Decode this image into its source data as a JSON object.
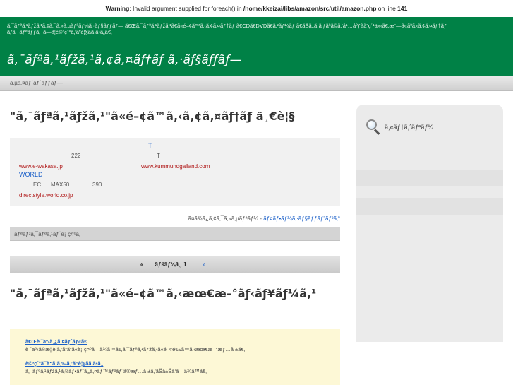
{
  "warning": {
    "label": "Warning",
    "message": ": Invalid argument supplied for foreach() in ",
    "path": "/home/kkeizai/libs/amazon/src/util/amazon.php",
    "line_text": " on line ",
    "line_number": "141"
  },
  "header": {
    "tagline": "ã‚¯ãƒªã‚¹ãƒžã‚¹ã‚¢ã‚¯ã‚»ã‚µãƒªãƒ¼ã‚·ãƒ§ãƒƒãƒ— ã€Œã‚¯ãƒªã‚¹ãƒžã‚¹ã€ã«é–¢ã™ã‚‹ã‚¢ã‚¤ãƒ†ãƒ ã€CDã€DVDã€ã‚²ãƒ¼ãƒ ã€ãŠã‚‚ã¡ã‚ƒãªã©ã‚’å¹…åºƒãã”ç´¹ä»‹ã€‚æ°—ã«ãªã‚‹ã‚¢ã‚¤ãƒ†ãƒ ã‚’ã‚¯ãƒªãƒƒã‚¯ã—ã¦è©³ç´°ã‚’ã”è¦§ãã ã•ã„ã€‚",
    "site_title": "ã‚¯ãƒªã‚¹ãƒžã‚¹ã‚¢ã‚¤ãƒ†ãƒ ã‚·ãƒ§ãƒƒãƒ—"
  },
  "breadcrumb": {
    "text": "ã‚µã‚¤ãƒˆãƒˆãƒƒãƒ—"
  },
  "main": {
    "page_title": "\"ã‚¯ãƒªã‚¹ãƒžã‚¹\"ã«é–¢ã™ã‚‹ã‚¢ã‚¤ãƒ†ãƒ ä¸€è¦§",
    "ad": {
      "t1": "T",
      "n222": "222",
      "t2": "T",
      "link1": "www.e-wakasa.jp",
      "link2": "www.kummundgalland.com",
      "world": "WORLD",
      "ec": "EC",
      "max": "MAX50",
      "n390": "390",
      "link3": "directstyle.world.co.jp"
    },
    "credit_text": "ã¤ã¾ã¿ã‚¢ã‚¯ã‚»ã‚µãƒªãƒ¼ - ",
    "credit_link": "ãƒ¤ãƒ•ãƒ¼ã‚·ãƒ§ãƒƒãƒ”ãƒ³ã‚°",
    "bar_text": "ãƒªãƒ³ã‚¯ãƒªã‚¹ãƒˆè¡¨ç¤ºã‚",
    "pager": {
      "prev": "«",
      "current": "ãƒšãƒ¼ã‚¸ 1",
      "next": "»"
    },
    "section_title": "\"ã‚¯ãƒªã‚¹ãƒžã‚¹\"ã«é–¢ã™ã‚‹æœ€æ–°ãƒ‹ãƒ¥ãƒ¼ã‚¹",
    "news": [
      {
        "title": "ã€Œè¨˜äº‹ã‚¿ã‚¤ãƒˆãƒ«ã€",
        "desc": "è¨˜äº‹ã®æ¦‚è¦ã‚’ã“ã“ã«è¡¨ç¤ºã—ã¾ã™ã€‚ã‚¯ãƒªã‚¹ãƒžã‚¹ã«é–¢é€£ã™ã‚‹æœ€æ–°æƒ…å ±ã€‚"
      },
      {
        "title": "è©³ç´°ã¯ã“ã¡ã‚‰ã‚’ã”è¦§ãã ã•ã„",
        "desc": "ã‚¯ãƒªã‚¹ãƒžã‚¹ã‚®ãƒ•ãƒˆã‚„ã‚¤ãƒ™ãƒ³ãƒˆã®æƒ…å ±ã‚’ãŠå±Šã‘ã—ã¾ã™ã€‚"
      }
    ]
  },
  "sidebar": {
    "search_title": "ã‚«ãƒ†ã‚´ãƒªãƒ¼"
  }
}
